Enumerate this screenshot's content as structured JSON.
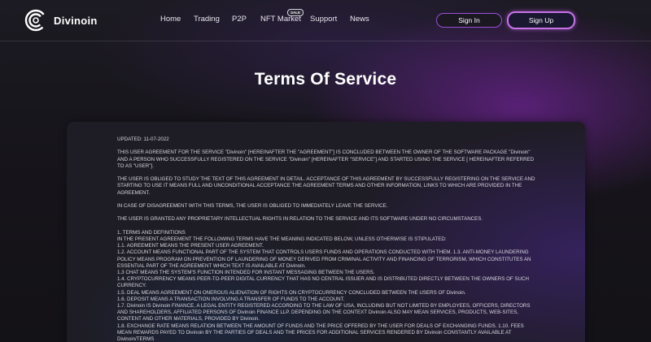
{
  "header": {
    "logo_text": "Divinoin",
    "nav": [
      {
        "label": "Home"
      },
      {
        "label": "Trading"
      },
      {
        "label": "P2P"
      },
      {
        "label": "NFT Market",
        "badge": "SALE"
      },
      {
        "label": "Support"
      },
      {
        "label": "News"
      }
    ],
    "signin_label": "Sign In",
    "signup_label": "Sign Up"
  },
  "page": {
    "title": "Terms Of Service"
  },
  "terms": {
    "updated": "UPDATED: 11-07-2022",
    "para1": "THIS USER AGREEMENT FOR THE SERVICE \"Divinoin\" [HEREINAFTER THE \"AGREEMENT\"] IS CONCLUDED BETWEEN THE OWNER OF THE SOFTWARE PACKAGE \"Divinoin\" AND A PERSON WHO SUCCESSFULLY REGISTERED ON THE SERVICE \"Divinoin\" [HEREINAFTER \"SERVICE\"] AND STARTED USING THE SERVICE [ HEREINAFTER REFERRED TO AS \"USER\"].",
    "para2": "THE USER IS OBLIGED TO STUDY THE TEXT OF THIS AGREEMENT IN DETAIL. ACCEPTANCE OF THIS AGREEMENT BY SUCCESSFULLY REGISTERING ON THE SERVICE AND STARTING TO USE IT MEANS FULL AND UNCONDITIONAL ACCEPTANCE THE AGREEMENT TERMS AND OTHER INFORMATION, LINKS TO WHICH ARE PROVIDED IN THE AGREEMENT.",
    "para3": "IN CASE OF DISAGREEMENT WITH THIS TERMS, THE USER IS OBLIGED TO IMMEDIATELY LEAVE THE SERVICE.",
    "para4": "THE USER IS GRANTED ANY PROPRIETARY INTELLECTUAL RIGHTS IN RELATION TO THE SERVICE AND ITS SOFTWARE UNDER NO CIRCUMSTANCES.",
    "section1": [
      "1. TERMS AND DEFINITIONS",
      "IN THE PRESENT AGREEMENT THE FOLLOWING TERMS HAVE THE MEANING INDICATED BELOW, UNLESS OTHERWISE IS STIPULATED:",
      "1.1. AGREEMENT MEANS THE PRESENT USER AGREEMENT.",
      "1.2. ACCOUNT MEANS FUNCTIONAL PART OF THE SYSTEM THAT CONTROLS USERS FUNDS AND OPERATIONS CONDUCTED WITH THEM. 1.3. ANTI-MONEY LAUNDERING POLICY MEANS PROGRAM ON PREVENTION OF LAUNDERING OF MONEY DERIVED FROM CRIMINAL ACTIVITY AND FINANCING OF TERRORISM, WHICH CONSTITUTES AN ESSENTIAL PART OF THE AGREEMENT WHICH TEXT IS AVAILABLE AT Divinoin.",
      "1.3 CHAT MEANS THE SYSTEM'S FUNCTION INTENDED FOR INSTANT MESSAGING BETWEEN THE USERS.",
      "1.4. CRYPTOCURRENCY MEANS PEER-TO-PEER DIGITAL CURRENCY THAT HAS NO CENTRAL ISSUER AND IS DISTRIBUTED DIRECTLY BETWEEN THE OWNERS OF SUCH CURRENCY.",
      "1.5. DEAL MEANS AGREEMENT ON ONEROUS ALIENATION OF RIGHTS ON CRYPTOCURRENCY CONCLUDED BETWEEN THE USERS OF Divinoin.",
      "1.6. DEPOSIT MEANS A TRANSACTION INVOLVING A TRANSFER OF FUNDS TO THE ACCOUNT.",
      "1.7. Divinoin IS Divinoin FINANCE, A LEGAL ENTITY REGISTERED ACCORDING TO THE LAW OF USA, INCLUDING BUT NOT LIMITED BY EMPLOYEES, OFFICERS, DIRECTORS AND SHAREHOLDERS, AFFILIATED PERSONS OF Divinoin FINANCE LLP. DEPENDING ON THE CONTEXT Divinoin ALSO MAY MEAN SERVICES, PRODUCTS, WEB-SITES, CONTENT AND OTHER MATERIALS, PROVIDED BY Divinoin.",
      "1.8. EXCHANGE RATE MEANS RELATION BETWEEN THE AMOUNT OF FUNDS AND THE PRICE OFFERED BY THE USER FOR DEALS OF EXCHANGING FUNDS. 1.10. FEES MEAN REWARDS PAYED TO Divinoin BY THE PARTIES OF DEALS AND THE PRICES FOR ADDITIONAL SERVICES RENDERED BY Divinoin CONSTANTLY AVAILABLE AT Divinoin/TERMS"
    ]
  }
}
